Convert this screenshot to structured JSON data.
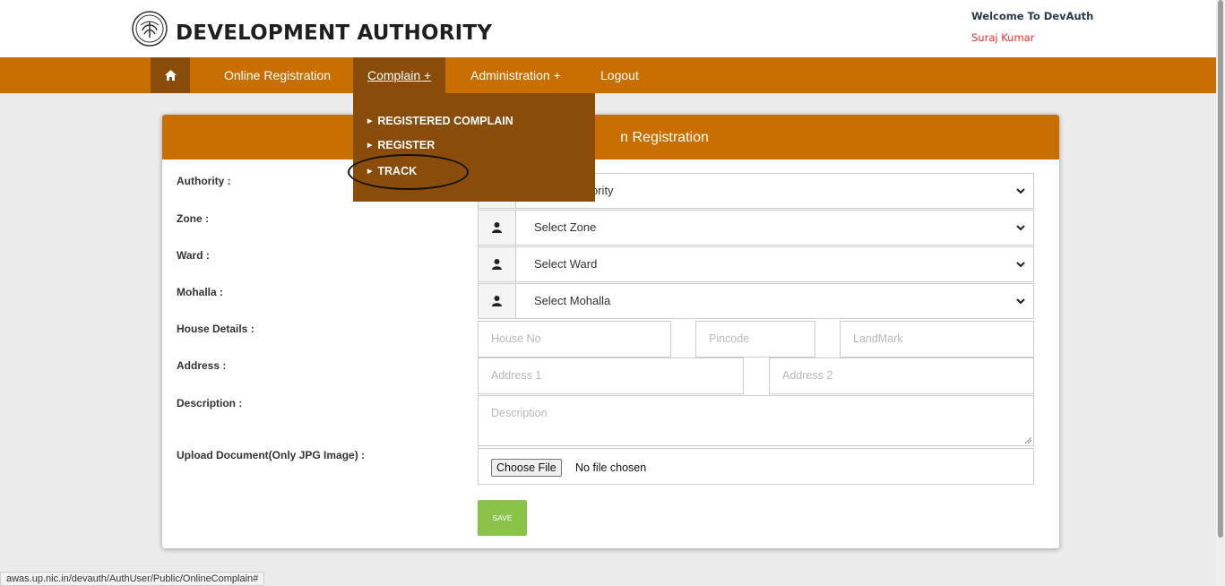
{
  "header": {
    "brand": "DEVELOPMENT AUTHORITY",
    "welcome": "Welcome To DevAuth",
    "user_name": "Suraj Kumar"
  },
  "navbar": {
    "items": [
      {
        "label": "Online Registration"
      },
      {
        "label": "Complain +"
      },
      {
        "label": "Administration +"
      },
      {
        "label": "Logout"
      }
    ]
  },
  "dropdown": {
    "items": [
      {
        "label": "REGISTERED COMPLAIN"
      },
      {
        "label": "REGISTER"
      },
      {
        "label": "TRACK"
      }
    ]
  },
  "form": {
    "title": "n Registration",
    "labels": {
      "authority": "Authority :",
      "zone": "Zone :",
      "ward": "Ward :",
      "mohalla": "Mohalla :",
      "house": "House Details :",
      "address": "Address :",
      "description": "Description :",
      "upload": "Upload Document(Only JPG Image) :"
    },
    "selects": {
      "authority": "ority",
      "zone": "Select Zone",
      "ward": "Select Ward",
      "mohalla": "Select Mohalla"
    },
    "placeholders": {
      "house_no": "House No",
      "pincode": "Pincode",
      "landmark": "LandMark",
      "address1": "Address 1",
      "address2": "Address 2",
      "description": "Description"
    },
    "file_button": "Choose File",
    "file_status": "No file chosen",
    "save": "SAVE"
  },
  "status_bar": {
    "url": "awas.up.nic.in/devauth/AuthUser/Public/OnlineComplain#"
  },
  "colors": {
    "nav": "#c96e00",
    "nav_active": "#8a4c0a",
    "save": "#8bc34a",
    "user": "#e03030"
  }
}
